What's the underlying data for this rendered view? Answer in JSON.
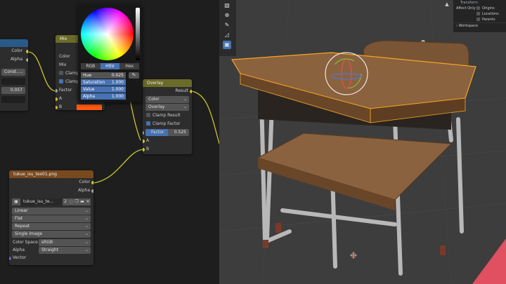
{
  "node_editor": {
    "left_node": {
      "outputs": [
        "Color",
        "Alpha"
      ],
      "dropdown": "Const...",
      "value": "0.057"
    },
    "mix_node": {
      "title": "Mix",
      "rows": [
        "Color",
        "Mix"
      ],
      "clamp_label": "Clamp",
      "clamp2_label": "Clamp",
      "inputs": [
        "Factor",
        "A",
        "B"
      ],
      "color_swatch": "#ff5a14"
    },
    "overlay_node": {
      "title": "Overlay",
      "output": "Result",
      "type_dropdown": "Color",
      "blend_dropdown": "Overlay",
      "clamp_result_label": "Clamp Result",
      "clamp_factor_label": "Clamp Factor",
      "factor_label": "Factor",
      "factor_value": "0.525",
      "inputs": [
        "A",
        "B"
      ]
    },
    "image_node": {
      "title": "tukue_isu_tex01.png",
      "outputs": [
        "Color",
        "Alpha"
      ],
      "image_name": "tukue_isu_te...",
      "users": "2",
      "interpolation": "Linear",
      "projection": "Flat",
      "extension": "Repeat",
      "source": "Single Image",
      "color_space_label": "Color Space",
      "color_space_value": "sRGB",
      "alpha_label": "Alpha",
      "alpha_value": "Straight",
      "vector_label": "Vector"
    }
  },
  "color_picker": {
    "tabs": [
      "RGB",
      "HSV",
      "Hex"
    ],
    "active_tab": "HSV",
    "fields": [
      {
        "label": "Hue",
        "value": "0.025"
      },
      {
        "label": "Saturation",
        "value": "1.000"
      },
      {
        "label": "Value",
        "value": "1.000"
      },
      {
        "label": "Alpha",
        "value": "1.000"
      }
    ],
    "eyedropper_icon": "eyedropper-icon"
  },
  "viewport": {
    "tools": [
      "select-icon",
      "cursor-icon",
      "move-icon",
      "scale-icon",
      "transform-icon"
    ],
    "options": {
      "title": "Transform",
      "affect_only": "Affect Only",
      "items": [
        "Origins",
        "Locations",
        "Parents"
      ],
      "workspace": "Workspace"
    }
  },
  "colors": {
    "accent": "#4772b3",
    "mix_header": "#6b6b29",
    "image_header": "#7a4a1f",
    "input_header": "#2a5a8a",
    "selection": "#f5a623"
  }
}
